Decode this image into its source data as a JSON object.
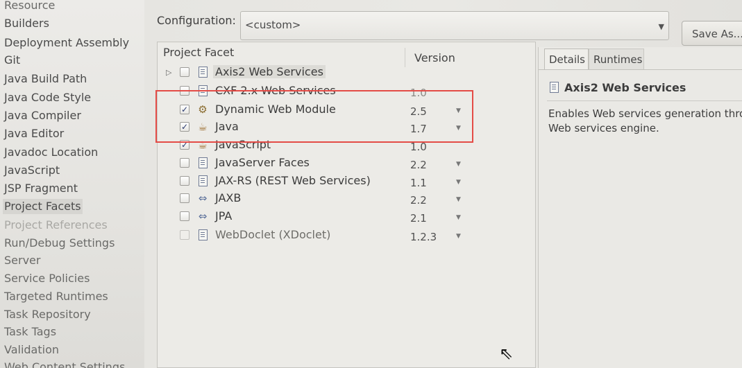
{
  "sidebar": {
    "items": [
      {
        "label": "Resource"
      },
      {
        "label": "Builders"
      },
      {
        "label": "Deployment Assembly"
      },
      {
        "label": "Git"
      },
      {
        "label": "Java Build Path"
      },
      {
        "label": "Java Code Style"
      },
      {
        "label": "Java Compiler"
      },
      {
        "label": "Java Editor"
      },
      {
        "label": "Javadoc Location"
      },
      {
        "label": "JavaScript"
      },
      {
        "label": "JSP Fragment"
      },
      {
        "label": "Project Facets",
        "selected": true
      },
      {
        "label": "Project References"
      },
      {
        "label": "Run/Debug Settings"
      },
      {
        "label": "Server"
      },
      {
        "label": "Service Policies"
      },
      {
        "label": "Targeted Runtimes"
      },
      {
        "label": "Task Repository"
      },
      {
        "label": "Task Tags"
      },
      {
        "label": "Validation"
      },
      {
        "label": "Web Content Settings"
      }
    ]
  },
  "config": {
    "label": "Configuration:",
    "value": "<custom>",
    "save_as": "Save As..."
  },
  "facets": {
    "col_facet": "Project Facet",
    "col_version": "Version",
    "rows": [
      {
        "name": "Axis2 Web Services",
        "version": "",
        "checked": false,
        "icon": "document-icon",
        "expandable": true
      },
      {
        "name": "CXF 2.x Web Services",
        "version": "1.0",
        "checked": false,
        "icon": "document-icon"
      },
      {
        "name": "Dynamic Web Module",
        "version": "2.5",
        "checked": true,
        "icon": "web-module-icon"
      },
      {
        "name": "Java",
        "version": "1.7",
        "checked": true,
        "icon": "java-icon"
      },
      {
        "name": "JavaScript",
        "version": "1.0",
        "checked": true,
        "icon": "javascript-icon"
      },
      {
        "name": "JavaServer Faces",
        "version": "2.2",
        "checked": false,
        "icon": "document-icon"
      },
      {
        "name": "JAX-RS (REST Web Services)",
        "version": "1.1",
        "checked": false,
        "icon": "document-icon"
      },
      {
        "name": "JAXB",
        "version": "2.2",
        "checked": false,
        "icon": "arrows-icon"
      },
      {
        "name": "JPA",
        "version": "2.1",
        "checked": false,
        "icon": "arrows-icon"
      },
      {
        "name": "WebDoclet (XDoclet)",
        "version": "1.2.3",
        "checked": false,
        "icon": "document-icon"
      }
    ]
  },
  "details": {
    "tab_details": "Details",
    "tab_runtimes": "Runtimes",
    "title": "Axis2 Web Services",
    "desc_line1": "Enables Web services generation thro",
    "desc_line2": "Web services engine."
  },
  "colors": {
    "highlight": "#e44b46",
    "check": "#2a3a70"
  }
}
